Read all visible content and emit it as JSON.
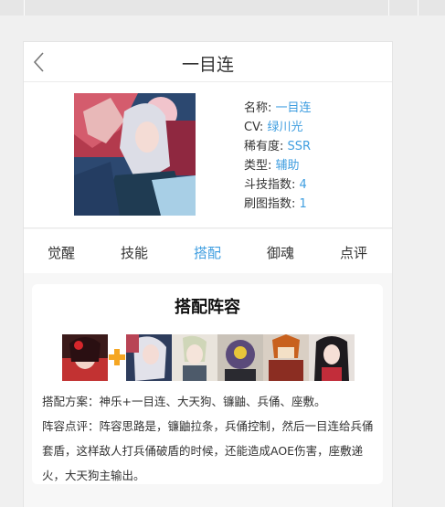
{
  "page": {
    "title": "一目连",
    "profile": {
      "rows": [
        {
          "label": "名称: ",
          "value": "一目连"
        },
        {
          "label": "CV: ",
          "value": "绿川光"
        },
        {
          "label": "稀有度: ",
          "value": "SSR"
        },
        {
          "label": "类型: ",
          "value": "辅助"
        },
        {
          "label": "斗技指数: ",
          "value": "4"
        },
        {
          "label": "刷图指数: ",
          "value": "1"
        }
      ]
    },
    "tabs": [
      "觉醒",
      "技能",
      "搭配",
      "御魂",
      "点评"
    ],
    "active_tab_index": 2,
    "lineup": {
      "title": "搭配阵容",
      "plan": "搭配方案：神乐+一目连、大天狗、镰鼬、兵俑、座敷。",
      "comment": "阵容点评：阵容思路是，镰鼬拉条，兵俑控制，然后一目连给兵俑套盾，这样敌人打兵俑破盾的时候，还能造成AOE伤害，座敷递火，大天狗主输出。"
    }
  },
  "colors": {
    "accent": "#3f9ee0",
    "text": "#333333",
    "background": "#f0f0f0",
    "plus": "#f5a623"
  },
  "icons": {
    "back": "chevron-left-icon",
    "plus": "plus-icon"
  }
}
